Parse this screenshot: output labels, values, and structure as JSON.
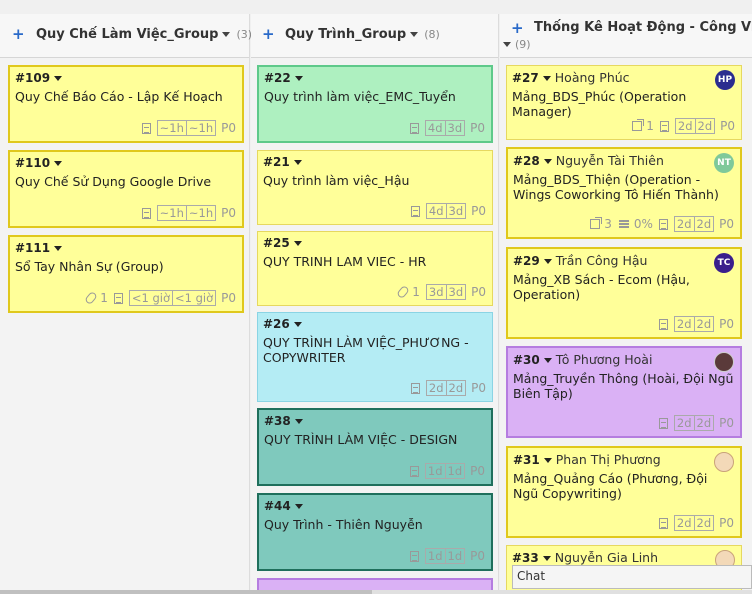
{
  "columns": [
    {
      "title": "Quy Chế Làm Việc_Group",
      "count": "(3)"
    },
    {
      "title": "Quy Trình_Group",
      "count": "(8)"
    },
    {
      "title": "Thống Kê Hoạt Động - Công Việc",
      "count": "(9)"
    }
  ],
  "col1": {
    "c109": {
      "num": "#109",
      "title": "Quy Chế Báo Cáo - Lập Kế Hoạch",
      "t1": "~1h",
      "t2": "~1h",
      "prio": "P0"
    },
    "c110": {
      "num": "#110",
      "title": "Quy Chế Sử Dụng Google Drive",
      "t1": "~1h",
      "t2": "~1h",
      "prio": "P0"
    },
    "c111": {
      "num": "#111",
      "title": "Sổ Tay Nhân Sự (Group)",
      "attach": "1",
      "t1": "<1 giờ",
      "t2": "<1 giờ",
      "prio": "P0"
    }
  },
  "col2": {
    "c22": {
      "num": "#22",
      "title": "Quy trình làm việc_EMC_Tuyển",
      "t1": "4d",
      "t2": "3d",
      "prio": "P0"
    },
    "c21": {
      "num": "#21",
      "title": "Quy trình làm việc_Hậu",
      "t1": "4d",
      "t2": "3d",
      "prio": "P0"
    },
    "c25": {
      "num": "#25",
      "title": "QUY TRINH LAM VIEC - HR",
      "attach": "1",
      "t1": "3d",
      "t2": "3d",
      "prio": "P0"
    },
    "c26": {
      "num": "#26",
      "title": "QUY TRÌNH LÀM VIỆC_PHƯƠNG - COPYWRITER",
      "t1": "2d",
      "t2": "2d",
      "prio": "P0"
    },
    "c38": {
      "num": "#38",
      "title": "QUY TRÌNH LÀM VIỆC - DESIGN",
      "t1": "1d",
      "t2": "1d",
      "prio": "P0"
    },
    "c44": {
      "num": "#44",
      "title": "Quy Trình - Thiên Nguyễn",
      "t1": "1d",
      "t2": "1d",
      "prio": "P0"
    }
  },
  "col3": {
    "c27": {
      "num": "#27",
      "assignee": "Hoàng Phúc",
      "initials": "HP",
      "title": "Mảng_BDS_Phúc (Operation Manager)",
      "sub": "1",
      "t1": "2d",
      "t2": "2d",
      "prio": "P0"
    },
    "c28": {
      "num": "#28",
      "assignee": "Nguyễn Tài Thiên",
      "initials": "NT",
      "title": "Mảng_BDS_Thiện (Operation - Wings Coworking Tô Hiến Thành)",
      "sub": "3",
      "pct": "0%",
      "t1": "2d",
      "t2": "2d",
      "prio": "P0"
    },
    "c29": {
      "num": "#29",
      "assignee": "Trần Công Hậu",
      "initials": "TC",
      "title": "Mảng_XB Sách - Ecom (Hậu, Operation)",
      "t1": "2d",
      "t2": "2d",
      "prio": "P0"
    },
    "c30": {
      "num": "#30",
      "assignee": "Tô Phương Hoài",
      "title": "Mảng_Truyền Thông (Hoài, Đội Ngũ Biên Tập)",
      "t1": "2d",
      "t2": "2d",
      "prio": "P0"
    },
    "c31": {
      "num": "#31",
      "assignee": "Phan Thị Phương",
      "title": "Mảng_Quảng Cáo (Phương, Đội Ngũ Copywriting)",
      "t1": "2d",
      "t2": "2d",
      "prio": "P0"
    },
    "c33": {
      "num": "#33",
      "assignee": "Nguyễn Gia Linh"
    }
  },
  "chat_label": "Chat",
  "colors": {
    "yellow": "#ffff99",
    "yellow_border": "#e0c81c",
    "green": "#aef0c0",
    "cyan": "#b4ecf4",
    "teal": "#7fc9bd",
    "teal_border": "#1f6f5c",
    "purple": "#dab1f5"
  }
}
